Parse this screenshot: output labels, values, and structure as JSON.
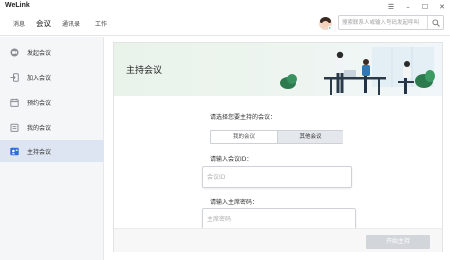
{
  "app": {
    "title": "WeLink"
  },
  "window_controls": {
    "menu": "☰",
    "minimize": "–",
    "maximize": "☐",
    "close": "✕"
  },
  "nav": {
    "tabs": [
      {
        "label": "消息"
      },
      {
        "label": "会议"
      },
      {
        "label": "通讯录"
      },
      {
        "label": "工作"
      }
    ],
    "active_index": 1
  },
  "search": {
    "placeholder": "搜索联系人或输入号码发起呼叫"
  },
  "sidebar": {
    "items": [
      {
        "label": "发起会议",
        "icon": "video-call-icon"
      },
      {
        "label": "加入会议",
        "icon": "join-arrow-icon"
      },
      {
        "label": "预约会议",
        "icon": "calendar-icon"
      },
      {
        "label": "我的会议",
        "icon": "my-meetings-icon"
      },
      {
        "label": "主持会议",
        "icon": "host-meeting-icon"
      }
    ],
    "active_index": 4
  },
  "main": {
    "title": "主持会议",
    "prompt": "请选择您要主持的会议：",
    "segment": {
      "options": [
        "我的会议",
        "其他会议"
      ],
      "selected_index": 1
    },
    "meeting_id": {
      "label": "请输入会议ID：",
      "placeholder": "会议ID",
      "value": ""
    },
    "host_password": {
      "label": "请输入主席密码：",
      "placeholder": "主席密码",
      "value": ""
    },
    "start_button": "开始主持"
  },
  "colors": {
    "accent": "#2f6bd9",
    "active_sidebar": "#dde5f2",
    "disabled_button": "#d2d6db"
  }
}
